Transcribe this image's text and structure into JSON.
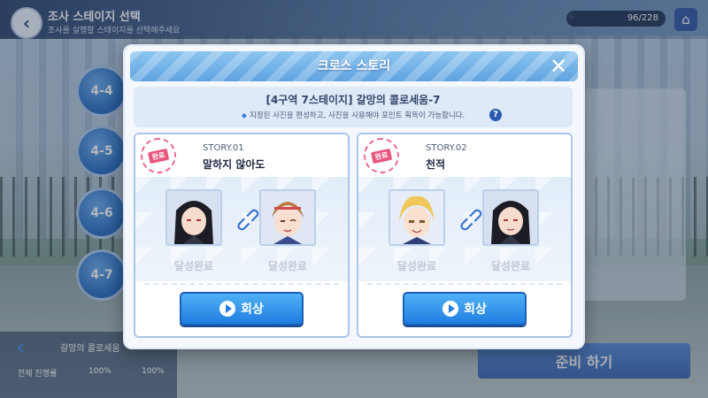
{
  "topbar": {
    "title": "조사 스테이지 선택",
    "subtitle": "조사를 실행할 스테이지를 선택해주세요",
    "stamina": "96/228"
  },
  "stage_list": [
    "4-4",
    "4-5",
    "4-6",
    "4-7"
  ],
  "bottom_left": {
    "title": "갈망의 콜로세움",
    "stat1": "전체 진행률",
    "stat2": "100%",
    "stat3": "100%"
  },
  "prepare_button": "준비 하기",
  "modal": {
    "title": "크로스 스토리",
    "info_title": "[4구역 7스테이지] 갈망의 콜로세움-7",
    "info_desc": "지정된 사진을 편성하고, 사진을 사용해야 포인트 획득이 가능합니다.",
    "help": "?",
    "stories": [
      {
        "stamp": "완료",
        "number": "STORY.01",
        "title": "말하지 않아도",
        "left_status": "달성완료",
        "right_status": "달성완료",
        "button": "회상"
      },
      {
        "stamp": "완료",
        "number": "STORY.02",
        "title": "천적",
        "left_status": "달성완료",
        "right_status": "달성완료",
        "button": "회상"
      }
    ]
  },
  "colors": {
    "accent": "#2f7fe0",
    "header": "#6aaee6",
    "stamp": "#e8577e"
  }
}
